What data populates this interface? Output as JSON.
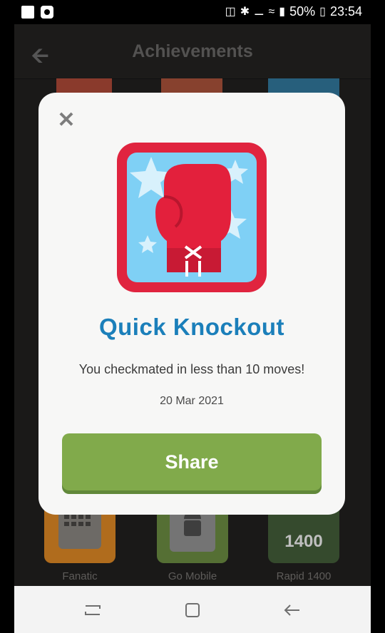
{
  "status_bar": {
    "battery": "50%",
    "time": "23:54"
  },
  "header": {
    "title": "Achievements"
  },
  "background_grid": [
    {
      "label": "Fanatic",
      "color": "#c3791f",
      "icon_text": ""
    },
    {
      "label": "Go Mobile",
      "color": "#5d7e35",
      "icon_text": ""
    },
    {
      "label": "Rapid 1400",
      "color": "#3c5533",
      "icon_text": "1400"
    }
  ],
  "modal": {
    "title": "Quick Knockout",
    "description": "You checkmated in less than 10 moves!",
    "date": "20 Mar 2021",
    "share_label": "Share",
    "badge_icon": "boxing-glove-icon"
  },
  "colors": {
    "title_blue": "#1b7fba",
    "share_green": "#81aa4b",
    "badge_red": "#e0243f",
    "badge_sky": "#7fd0f5"
  }
}
